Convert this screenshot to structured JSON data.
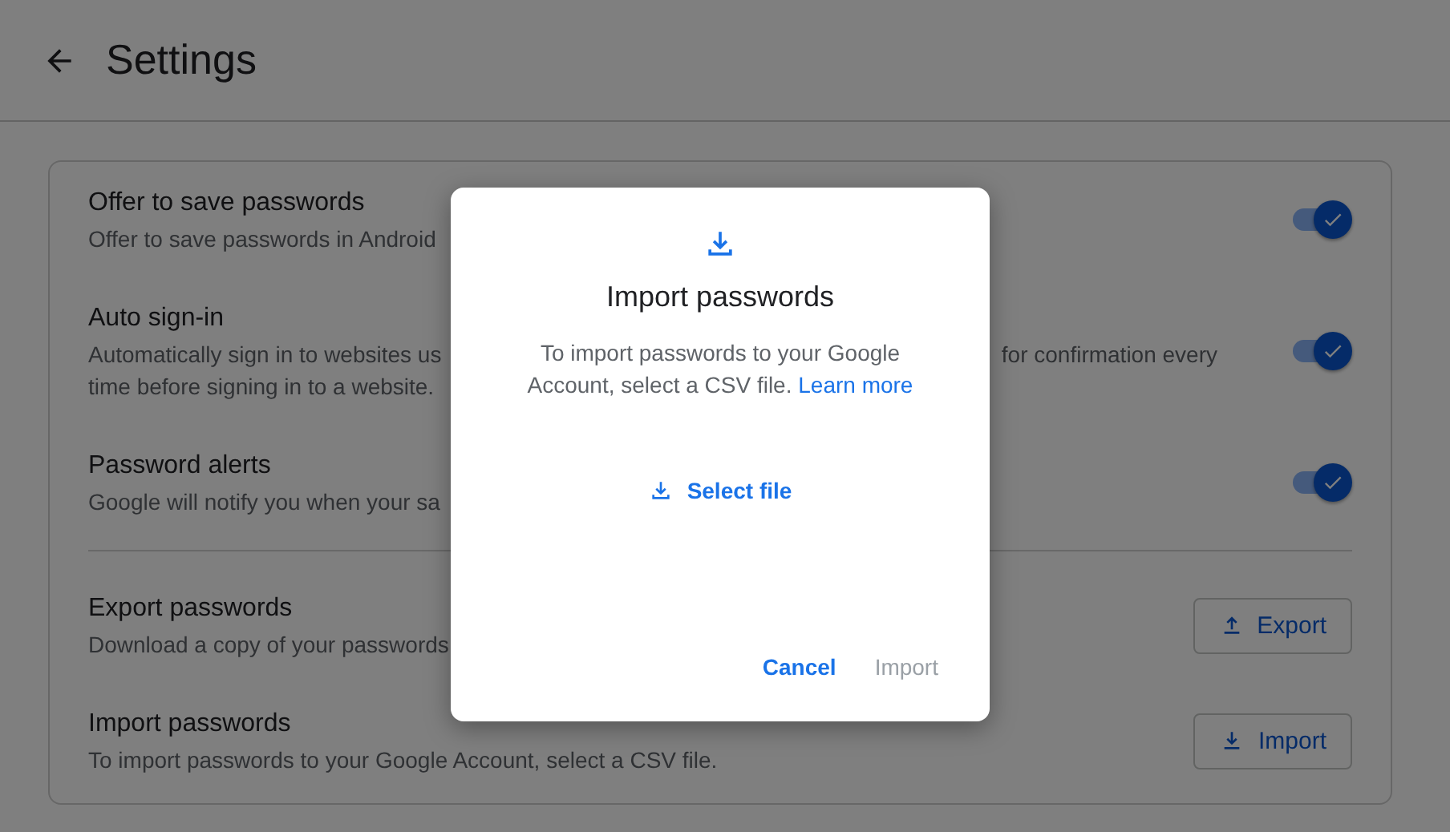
{
  "header": {
    "title": "Settings"
  },
  "settings": [
    {
      "kind": "toggle",
      "title": "Offer to save passwords",
      "lines": [
        [
          "Offer to save passwords in Android"
        ]
      ],
      "on": true
    },
    {
      "kind": "toggle",
      "title": "Auto sign-in",
      "lines": [
        [
          "Automatically sign in to websites us",
          "for confirmation every"
        ],
        [
          "time before signing in to a website."
        ]
      ],
      "on": true
    },
    {
      "kind": "toggle",
      "title": "Password alerts",
      "lines": [
        [
          "Google will notify you when your sa"
        ]
      ],
      "on": true
    },
    {
      "kind": "export",
      "title": "Export passwords",
      "lines": [
        [
          "Download a copy of your passwords"
        ]
      ],
      "button": "Export"
    },
    {
      "kind": "import",
      "title": "Import passwords",
      "lines": [
        [
          "To import passwords to your Google Account, select a CSV file."
        ]
      ],
      "button": "Import"
    }
  ],
  "dialog": {
    "title": "Import passwords",
    "body": "To import passwords to your Google Account, select a CSV file.",
    "link": "Learn more",
    "select_button": "Select file",
    "buttons": [
      {
        "label": "Cancel",
        "disabled": false
      },
      {
        "label": "Import",
        "disabled": true
      }
    ]
  }
}
